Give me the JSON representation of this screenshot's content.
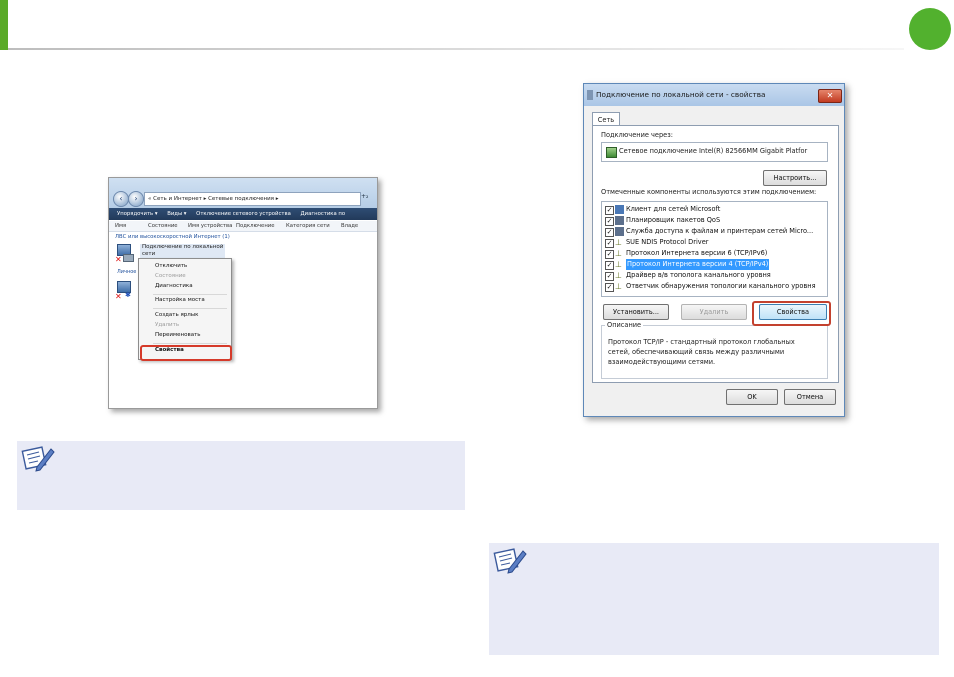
{
  "header": {
    "accent_color": "#5aaa28",
    "badge_color": "#52b12e"
  },
  "explorer_window": {
    "address": "« Сеть и Интернет ▸ Сетевые подключения ▸",
    "address_refresh": "+₂",
    "toolbar": [
      "Упорядочить ▾",
      "Виды ▾",
      "Отключение сетевого устройства",
      "Диагностика по"
    ],
    "columns": [
      "Имя",
      "Состояние",
      "Имя устройства",
      "Подключение",
      "Категория сети",
      "Владе"
    ],
    "group_label": "ЛВС или высокоскоростной Интернет (1)",
    "connection_name_line1": "Подключение по локальной",
    "connection_name_line2": "сети",
    "side_label": "Личное",
    "context_menu": {
      "items": [
        {
          "label": "Отключить",
          "disabled": false
        },
        {
          "label": "Состояние",
          "disabled": true
        },
        {
          "label": "Диагностика",
          "disabled": false
        },
        {
          "label": "Настройка моста",
          "disabled": false
        },
        {
          "label": "Создать ярлык",
          "disabled": false
        },
        {
          "label": "Удалить",
          "disabled": true
        },
        {
          "label": "Переименовать",
          "disabled": false
        },
        {
          "label": "Свойства",
          "disabled": false
        }
      ],
      "highlighted": "Свойства"
    }
  },
  "properties_dialog": {
    "title": "Подключение по локальной сети - свойства",
    "close_label": "✕",
    "tab": "Сеть",
    "connect_via_label": "Подключение через:",
    "adapter_name": "Сетевое подключение Intel(R) 82566MM Gigabit Platfor",
    "configure_button": "Настроить...",
    "components_label": "Отмеченные компоненты используются этим подключением:",
    "components": [
      {
        "label": "Клиент для сетей Microsoft",
        "checked": true,
        "selected": false
      },
      {
        "label": "Планировщик пакетов QoS",
        "checked": true,
        "selected": false
      },
      {
        "label": "Служба доступа к файлам и принтерам сетей Micro...",
        "checked": true,
        "selected": false
      },
      {
        "label": "SUE NDIS Protocol Driver",
        "checked": true,
        "selected": false
      },
      {
        "label": "Протокол Интернета версии 6 (TCP/IPv6)",
        "checked": true,
        "selected": false
      },
      {
        "label": "Протокол Интернета версии 4 (TCP/IPv4)",
        "checked": true,
        "selected": true
      },
      {
        "label": "Драйвер в/в тополога канального уровня",
        "checked": true,
        "selected": false
      },
      {
        "label": "Ответчик обнаружения топологии канального уровня",
        "checked": true,
        "selected": false
      }
    ],
    "install_button": "Установить...",
    "uninstall_button": "Удалить",
    "properties_button": "Свойства",
    "description_label": "Описание",
    "description_text": [
      "Протокол TCP/IP - стандартный протокол глобальных",
      "сетей, обеспечивающий связь между различными",
      "взаимодействующими сетями."
    ],
    "ok_button": "OK",
    "cancel_button": "Отмена"
  },
  "notes": {
    "background_color": "#e8eaf6",
    "icon": "note-pencil-icon"
  }
}
